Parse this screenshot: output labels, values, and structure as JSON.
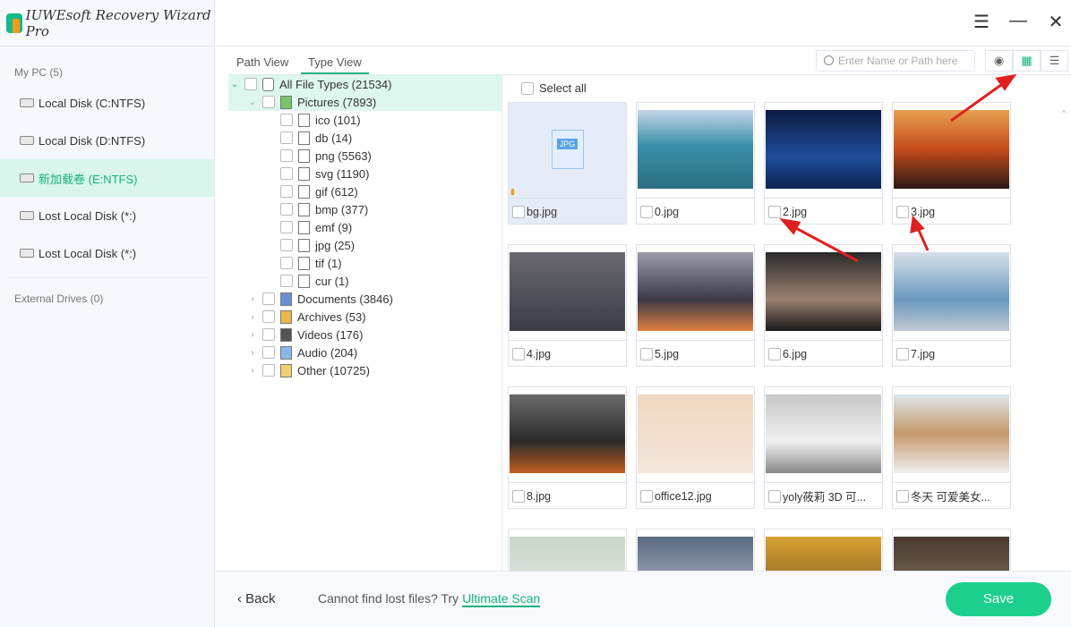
{
  "app": {
    "title": "IUWEsoft Recovery Wizard Pro",
    "brand_color": "#13b27c"
  },
  "window": {
    "menu_icon": "hamburger-icon",
    "minimize_icon": "minimize-icon",
    "close_icon": "close-icon"
  },
  "sidebar": {
    "my_pc": "My PC (5)",
    "disks": [
      {
        "label": "Local Disk (C:NTFS)"
      },
      {
        "label": "Local Disk (D:NTFS)"
      },
      {
        "label": "新加载卷 (E:NTFS)",
        "active": true
      },
      {
        "label": "Lost Local Disk (*:)"
      },
      {
        "label": "Lost Local Disk (*:)"
      }
    ],
    "external": "External Drives (0)"
  },
  "tabs": [
    {
      "label": "Path View"
    },
    {
      "label": "Type View",
      "active": true
    }
  ],
  "search": {
    "placeholder": "Enter Name or Path here"
  },
  "view_buttons": [
    "eye-icon",
    "grid-icon",
    "list-icon"
  ],
  "tree": {
    "root": "All File Types (21534)",
    "pictures": "Pictures (7893)",
    "picture_types": [
      "ico (101)",
      "db (14)",
      "png (5563)",
      "svg (1190)",
      "gif (612)",
      "bmp (377)",
      "emf (9)",
      "jpg (25)",
      "tif (1)",
      "cur (1)"
    ],
    "others": [
      "Documents (3846)",
      "Archives (53)",
      "Videos (176)",
      "Audio (204)",
      "Other (10725)"
    ]
  },
  "grid": {
    "select_all": "Select all",
    "files": [
      "bg.jpg",
      "0.jpg",
      "2.jpg",
      "3.jpg",
      "4.jpg",
      "5.jpg",
      "6.jpg",
      "7.jpg",
      "8.jpg",
      "office12.jpg",
      "yoly莜莉 3D 可...",
      "冬天 可爱美女...",
      "",
      "",
      "",
      ""
    ]
  },
  "bottom": {
    "back": "Back",
    "hint": "Cannot find lost files? Try",
    "ultimate": "Ultimate Scan",
    "save": "Save"
  }
}
